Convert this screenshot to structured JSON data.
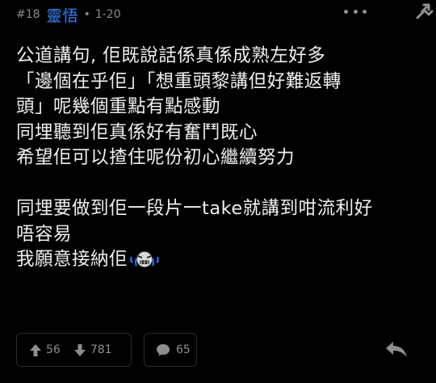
{
  "post": {
    "number": "#18",
    "username": "靈悟",
    "separator": "•",
    "time_ago": "1-20"
  },
  "header_icons": {
    "more": "more-horizontal-icon",
    "quote": "quote-reply-icon"
  },
  "content": {
    "lines": [
      "公道講句, 佢既說話係真係成熟左好多",
      "「邊個在乎佢」「想重頭黎講但好難返轉",
      "頭」呢幾個重點有點感動",
      "同埋聽到佢真係好有奮鬥既心",
      "希望佢可以揸住呢份初心繼續努力",
      "",
      "同埋要做到佢一段片一take就講到咁流利好",
      "唔容易",
      "我願意接納佢"
    ],
    "emoji": "crying-face-sticker-icon"
  },
  "footer": {
    "upvotes": "56",
    "downvotes": "781",
    "comments": "65"
  },
  "colors": {
    "background": "#000000",
    "text": "#efefef",
    "username": "#3a86ff",
    "muted": "#8a8a8a",
    "border": "#2b2b2b"
  }
}
